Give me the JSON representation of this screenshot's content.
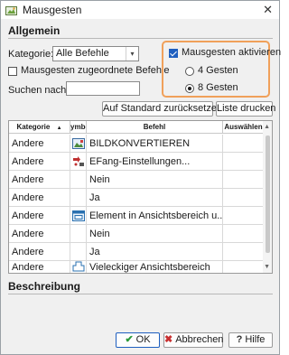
{
  "window": {
    "title": "Mausgesten",
    "close_glyph": "✕"
  },
  "allgemein": {
    "heading": "Allgemein",
    "kategorie_label": "Kategorie:",
    "kategorie_value": "Alle Befehle",
    "zugeordnete_label": "Mausgesten zugeordnete Befehle",
    "zugeordnete_checked": false,
    "suchen_label": "Suchen nach:",
    "suchen_value": ""
  },
  "aktivieren": {
    "label": "Mausgesten aktivieren",
    "checked": true,
    "options": [
      {
        "label": "4 Gesten",
        "checked": false
      },
      {
        "label": "8 Gesten",
        "checked": true
      }
    ]
  },
  "buttons": {
    "reset": "Auf Standard zurücksetzen",
    "print": "Liste drucken",
    "ok": "OK",
    "cancel": "Abbrechen",
    "help": "Hilfe",
    "ok_glyph": "✔",
    "cancel_glyph": "✖",
    "help_glyph": "?"
  },
  "table": {
    "columns": [
      "Kategorie",
      "ymbo",
      "Befehl",
      "Auswählen"
    ],
    "sort_glyph": "▲",
    "rows": [
      {
        "kategorie": "Andere",
        "icon": "image-icon",
        "befehl": "BILDKONVERTIEREN"
      },
      {
        "kategorie": "Andere",
        "icon": "settings-arrow-icon",
        "befehl": "EFang-Einstellungen..."
      },
      {
        "kategorie": "Andere",
        "icon": "",
        "befehl": "Nein"
      },
      {
        "kategorie": "Andere",
        "icon": "",
        "befehl": "Ja"
      },
      {
        "kategorie": "Andere",
        "icon": "viewport-icon",
        "befehl": "Element in Ansichtsbereich u..."
      },
      {
        "kategorie": "Andere",
        "icon": "",
        "befehl": "Nein"
      },
      {
        "kategorie": "Andere",
        "icon": "",
        "befehl": "Ja"
      },
      {
        "kategorie": "Andere",
        "icon": "polygon-viewport-icon",
        "befehl": "Vieleckiger Ansichtsbereich"
      }
    ]
  },
  "beschreibung": {
    "heading": "Beschreibung"
  },
  "colors": {
    "accent": "#1f5fbf",
    "highlight": "#f0a05a"
  }
}
